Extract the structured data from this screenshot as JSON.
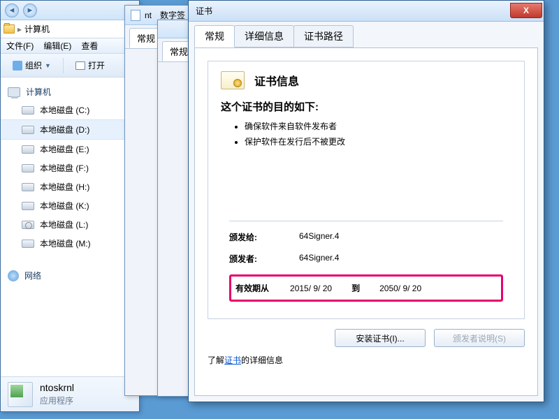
{
  "explorer": {
    "address_label": "计算机",
    "menubar": {
      "file": "文件(F)",
      "edit": "编辑(E)",
      "view": "查看"
    },
    "toolbar": {
      "organize": "组织",
      "open": "打开"
    },
    "tree": {
      "computer": "计算机",
      "drives": [
        {
          "label": "本地磁盘 (C:)",
          "kind": "disk"
        },
        {
          "label": "本地磁盘 (D:)",
          "kind": "disk",
          "selected": true
        },
        {
          "label": "本地磁盘 (E:)",
          "kind": "disk"
        },
        {
          "label": "本地磁盘 (F:)",
          "kind": "disk"
        },
        {
          "label": "本地磁盘 (H:)",
          "kind": "disk"
        },
        {
          "label": "本地磁盘 (K:)",
          "kind": "disk"
        },
        {
          "label": "本地磁盘 (L:)",
          "kind": "cd"
        },
        {
          "label": "本地磁盘 (M:)",
          "kind": "disk"
        }
      ],
      "network": "网络"
    },
    "footer": {
      "filename": "ntoskrnl",
      "filetype": "应用程序"
    }
  },
  "midwin": {
    "title_prefix": "nt",
    "title2": "数字签",
    "tab": "常规"
  },
  "midwin2": {
    "tab": "常规"
  },
  "cert": {
    "title": "证书",
    "close_glyph": "X",
    "tabs": {
      "general": "常规",
      "details": "详细信息",
      "certpath": "证书路径"
    },
    "heading": "证书信息",
    "purpose_title": "这个证书的目的如下:",
    "purposes": [
      "确保软件来自软件发布者",
      "保护软件在发行后不被更改"
    ],
    "issued_to_label": "颁发给:",
    "issued_to": "64Signer.4",
    "issued_by_label": "颁发者:",
    "issued_by": "64Signer.4",
    "valid_label": "有效期从",
    "valid_from": "2015/  9/  20",
    "valid_to_label": "到",
    "valid_to": "2050/  9/  20",
    "install_btn": "安装证书(I)...",
    "issuer_btn": "颁发者说明(S)",
    "learn_prefix": "了解",
    "learn_link": "证书",
    "learn_suffix": "的详细信息"
  }
}
